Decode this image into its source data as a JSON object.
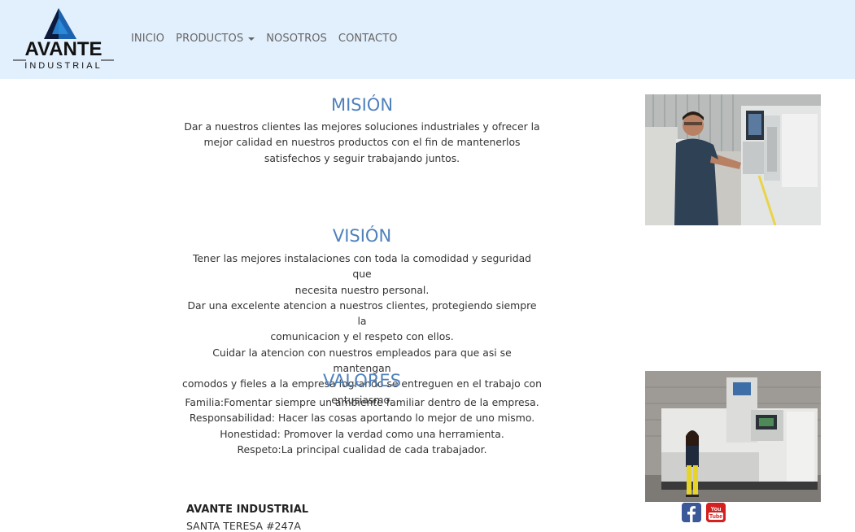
{
  "brand": {
    "name": "AVANTE",
    "tagline": "INDUSTRIAL",
    "accent_color": "#1f77c9"
  },
  "nav": {
    "items": [
      {
        "label": "INICIO"
      },
      {
        "label": "PRODUCTOS",
        "dropdown": true
      },
      {
        "label": "NOSOTROS"
      },
      {
        "label": "CONTACTO"
      }
    ]
  },
  "mision": {
    "title": "MISIÓN",
    "lines": [
      "Dar a nuestros clientes las mejores soluciones industriales y ofrecer la",
      "mejor calidad en nuestros productos con el fin de mantenerlos",
      "satisfechos y seguir trabajando juntos."
    ]
  },
  "vision": {
    "title": "VISIÓN",
    "lines": [
      "Tener las mejores instalaciones con toda la comodidad y seguridad que",
      "necesita nuestro personal.",
      "Dar una excelente atencion a nuestros clientes, protegiendo siempre la",
      "comunicacion y el respeto con ellos.",
      "Cuidar la atencion con nuestros empleados para que asi se mantengan",
      "comodos y fieles a la empresa logrando se entreguen en el trabajo con",
      "entusiasmo."
    ]
  },
  "valores": {
    "title": "VALORES",
    "lines": [
      "Familia:Fomentar siempre un ambiente familiar dentro de la empresa.",
      "Responsabilidad: Hacer las cosas aportando lo mejor de uno mismo.",
      "Honestidad: Promover la verdad como una herramienta.",
      "Respeto:La principal cualidad de cada trabajador."
    ]
  },
  "footer": {
    "company": "AVANTE INDUSTRIAL",
    "address": "SANTA TERESA #247A"
  },
  "social": {
    "facebook_icon": "facebook-icon",
    "youtube_icon": "youtube-icon",
    "youtube_text_top": "You",
    "youtube_text_bottom": "Tube"
  },
  "colors": {
    "header_bg": "#e2effc",
    "heading": "#4f81bd"
  }
}
